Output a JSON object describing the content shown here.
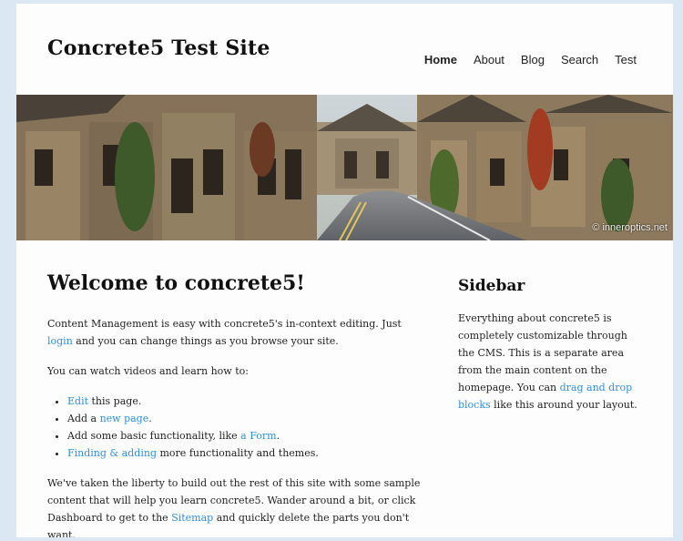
{
  "site": {
    "title": "Concrete5 Test Site"
  },
  "nav": {
    "items": [
      {
        "label": "Home",
        "active": true
      },
      {
        "label": "About"
      },
      {
        "label": "Blog"
      },
      {
        "label": "Search"
      },
      {
        "label": "Test"
      }
    ]
  },
  "hero": {
    "watermark": "© inneroptics.net"
  },
  "main": {
    "heading": "Welcome to concrete5!",
    "p1": {
      "before": "Content Management is easy with concrete5's in-context editing. Just ",
      "link": "login",
      "after": " and you can change things as you browse your site."
    },
    "p2": "You can watch videos and learn how to:",
    "list": [
      {
        "before": "",
        "link": "Edit",
        "after": " this page."
      },
      {
        "before": "Add a ",
        "link": "new page",
        "after": "."
      },
      {
        "before": "Add some basic functionality, like ",
        "link": "a Form",
        "after": "."
      },
      {
        "before": "",
        "link": "Finding & adding",
        "after": " more functionality and themes."
      }
    ],
    "p3": {
      "before": "We've taken the liberty to build out the rest of this site with some sample content that will help you learn concrete5. Wander around a bit, or click Dashboard to get to the ",
      "link": "Sitemap",
      "after": " and quickly delete the parts you don't want."
    }
  },
  "sidebar": {
    "heading": "Sidebar",
    "text": {
      "before": "Everything about concrete5 is completely customizable through the CMS. This is a separate area from the main content on the homepage. You can ",
      "link": "drag and drop blocks",
      "after": " like this around your layout."
    }
  },
  "colors": {
    "link": "#2d8fe0",
    "page_bg": "#fdfdfd",
    "outer_bg": "#dbe7f3"
  }
}
